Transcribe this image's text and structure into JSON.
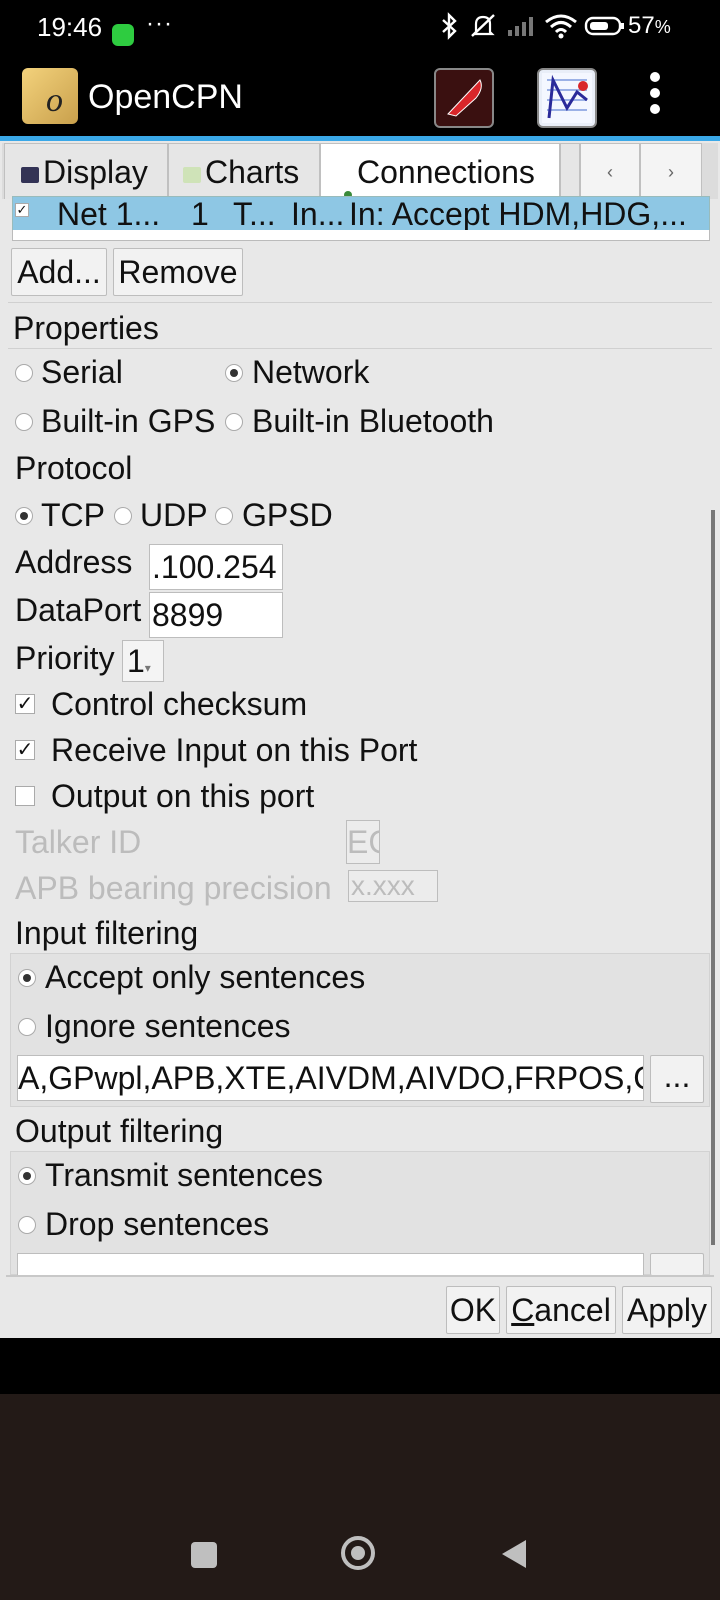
{
  "status_bar": {
    "time": "19:46",
    "dots": "···",
    "battery": "57",
    "battery_unit": "%",
    "icons": [
      "whatsapp-icon",
      "bluetooth-icon",
      "mute-icon",
      "signal-icon",
      "wifi-icon",
      "battery-icon"
    ]
  },
  "app_bar": {
    "title": "OpenCPN",
    "logo_glyph": "o"
  },
  "tabs": [
    {
      "label": "Display",
      "selected": false
    },
    {
      "label": "Charts",
      "selected": false
    },
    {
      "label": "Connections",
      "selected": true
    }
  ],
  "tab_nav": {
    "prev": "‹",
    "next": "›"
  },
  "connection_row": {
    "checked": true,
    "name": "Net 1...",
    "priority": "1",
    "type": "T...",
    "direction": "In...",
    "filters": "In: Accept HDM,HDG,..."
  },
  "list_buttons": {
    "add": "Add...",
    "remove": "Remove"
  },
  "properties": {
    "heading": "Properties",
    "serial": "Serial",
    "network": "Network",
    "builtin_gps": "Built-in GPS",
    "builtin_bluetooth": "Built-in Bluetooth",
    "selected": "network"
  },
  "protocol": {
    "heading": "Protocol",
    "tcp": "TCP",
    "udp": "UDP",
    "gpsd": "GPSD",
    "selected": "tcp"
  },
  "address": {
    "label": "Address",
    "value": ".100.254"
  },
  "dataport": {
    "label": "DataPort",
    "value": "8899"
  },
  "priority": {
    "label": "Priority",
    "value": "1"
  },
  "options": {
    "control_checksum": {
      "label": "Control checksum",
      "checked": true
    },
    "receive_input": {
      "label": "Receive Input on this Port",
      "checked": true
    },
    "output_port": {
      "label": "Output on this port",
      "checked": false
    }
  },
  "talker_id": {
    "label": "Talker ID",
    "value": "EC"
  },
  "apb_precision": {
    "label": "APB bearing precision",
    "value": "x.xxx"
  },
  "input_filtering": {
    "heading": "Input filtering",
    "accept": "Accept only sentences",
    "ignore": "Ignore sentences",
    "selected": "accept",
    "sentences": "A,GPwpl,APB,XTE,AIVDM,AIVDO,FRPOS,CD",
    "more": "..."
  },
  "output_filtering": {
    "heading": "Output filtering",
    "transmit": "Transmit sentences",
    "drop": "Drop sentences",
    "selected": "transmit"
  },
  "dialog_buttons": {
    "ok": "OK",
    "cancel": "Cancel",
    "cancel_mnemonic": "C",
    "cancel_rest": "ancel",
    "apply": "Apply"
  }
}
